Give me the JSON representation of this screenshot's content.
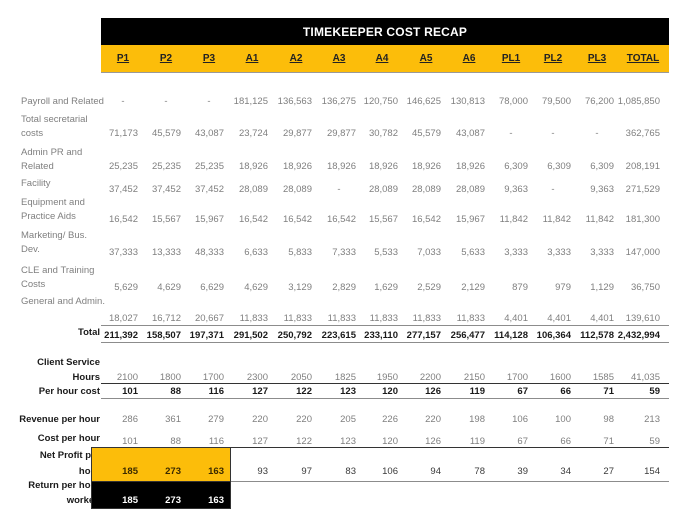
{
  "title": "TIMEKEEPER COST RECAP",
  "columns": [
    "P1",
    "P2",
    "P3",
    "A1",
    "A2",
    "A3",
    "A4",
    "A5",
    "A6",
    "PL1",
    "PL2",
    "PL3",
    "TOTAL"
  ],
  "cost_rows": [
    {
      "label": "Payroll and Related",
      "values": [
        "-",
        "-",
        "-",
        "181,125",
        "136,563",
        "136,275",
        "120,750",
        "146,625",
        "130,813",
        "78,000",
        "79,500",
        "76,200",
        "1,085,850"
      ]
    },
    {
      "label": "Total secretarial costs",
      "values": [
        "71,173",
        "45,579",
        "43,087",
        "23,724",
        "29,877",
        "29,877",
        "30,782",
        "45,579",
        "43,087",
        "-",
        "-",
        "-",
        "362,765"
      ]
    },
    {
      "label": "Admin PR and Related",
      "values": [
        "25,235",
        "25,235",
        "25,235",
        "18,926",
        "18,926",
        "18,926",
        "18,926",
        "18,926",
        "18,926",
        "6,309",
        "6,309",
        "6,309",
        "208,191"
      ]
    },
    {
      "label": "Facility",
      "values": [
        "37,452",
        "37,452",
        "37,452",
        "28,089",
        "28,089",
        "-",
        "28,089",
        "28,089",
        "28,089",
        "9,363",
        "-",
        "9,363",
        "271,529"
      ]
    },
    {
      "label": "Equipment and Practice Aids",
      "values": [
        "16,542",
        "15,567",
        "15,967",
        "16,542",
        "16,542",
        "16,542",
        "15,567",
        "16,542",
        "15,967",
        "11,842",
        "11,842",
        "11,842",
        "181,300"
      ]
    },
    {
      "label": "Marketing/ Bus. Dev.",
      "values": [
        "37,333",
        "13,333",
        "48,333",
        "6,633",
        "5,833",
        "7,333",
        "5,533",
        "7,033",
        "5,633",
        "3,333",
        "3,333",
        "3,333",
        "147,000"
      ]
    },
    {
      "label": "CLE and Training Costs",
      "values": [
        "5,629",
        "4,629",
        "6,629",
        "4,629",
        "3,129",
        "2,829",
        "1,629",
        "2,529",
        "2,129",
        "879",
        "979",
        "1,129",
        "36,750"
      ]
    },
    {
      "label": "General and Admin.",
      "values": [
        "18,027",
        "16,712",
        "20,667",
        "11,833",
        "11,833",
        "11,833",
        "11,833",
        "11,833",
        "11,833",
        "4,401",
        "4,401",
        "4,401",
        "139,610"
      ]
    }
  ],
  "total_row": {
    "label": "Total",
    "values": [
      "211,392",
      "158,507",
      "197,371",
      "291,502",
      "250,792",
      "223,615",
      "233,110",
      "277,157",
      "256,477",
      "114,128",
      "106,364",
      "112,578",
      "2,432,994"
    ]
  },
  "hours_row": {
    "label_line1": "Client Service",
    "label_line2": "Hours",
    "values": [
      "2100",
      "1800",
      "1700",
      "2300",
      "2050",
      "1825",
      "1950",
      "2200",
      "2150",
      "1700",
      "1600",
      "1585",
      "41,035"
    ]
  },
  "per_hour_cost_row": {
    "label": "Per hour cost",
    "values": [
      "101",
      "88",
      "116",
      "127",
      "122",
      "123",
      "120",
      "126",
      "119",
      "67",
      "66",
      "71",
      "59"
    ]
  },
  "revenue_row": {
    "label": "Revenue per hour",
    "values": [
      "286",
      "361",
      "279",
      "220",
      "220",
      "205",
      "226",
      "220",
      "198",
      "106",
      "100",
      "98",
      "213"
    ]
  },
  "cost_per_hour_row": {
    "label": "Cost per hour",
    "values": [
      "101",
      "88",
      "116",
      "127",
      "122",
      "123",
      "120",
      "126",
      "119",
      "67",
      "66",
      "71",
      "59"
    ]
  },
  "net_profit_row": {
    "label_line1": "Net Profit per",
    "label_line2": "hour",
    "values": [
      "185",
      "273",
      "163",
      "93",
      "97",
      "83",
      "106",
      "94",
      "78",
      "39",
      "34",
      "27",
      "154"
    ]
  },
  "return_row": {
    "label_line1": "Return per hour",
    "label_line2": "worked",
    "values": [
      "185",
      "273",
      "163"
    ]
  },
  "colors": {
    "accent": "#fcbd0a",
    "header_bg": "#000000",
    "text_grey": "#7f7f7f",
    "text_dark": "#1a1a1a"
  }
}
